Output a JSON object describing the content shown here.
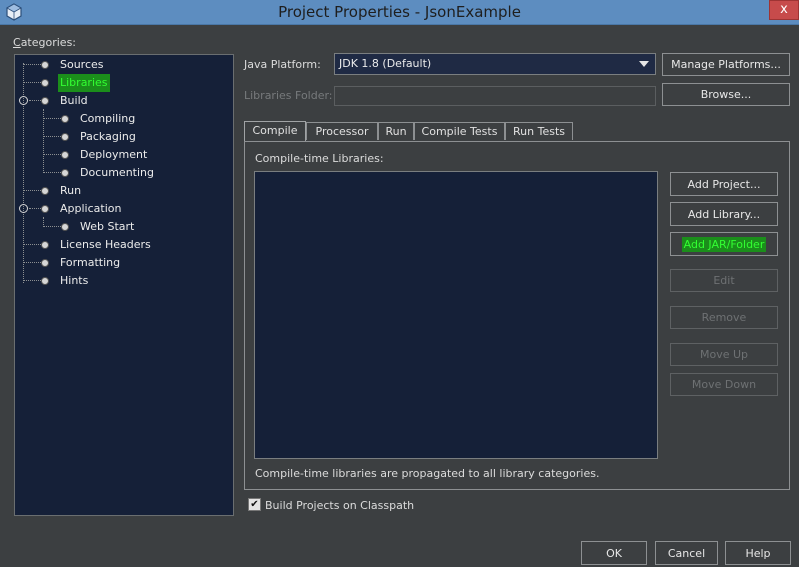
{
  "window": {
    "title": "Project Properties - JsonExample",
    "close_glyph": "x"
  },
  "categories": {
    "label": "Categories:",
    "items": [
      {
        "label": "Sources",
        "level": 0
      },
      {
        "label": "Libraries",
        "level": 0,
        "selected": true
      },
      {
        "label": "Build",
        "level": 0,
        "expanded": true
      },
      {
        "label": "Compiling",
        "level": 1
      },
      {
        "label": "Packaging",
        "level": 1
      },
      {
        "label": "Deployment",
        "level": 1
      },
      {
        "label": "Documenting",
        "level": 1
      },
      {
        "label": "Run",
        "level": 0
      },
      {
        "label": "Application",
        "level": 0,
        "expanded": true
      },
      {
        "label": "Web Start",
        "level": 1
      },
      {
        "label": "License Headers",
        "level": 0
      },
      {
        "label": "Formatting",
        "level": 0
      },
      {
        "label": "Hints",
        "level": 0
      }
    ]
  },
  "platform": {
    "label": "Java Platform:",
    "value": "JDK 1.8 (Default)",
    "manage_button": "Manage Platforms..."
  },
  "libraries_folder": {
    "label": "Libraries Folder:",
    "value": "",
    "browse_button": "Browse..."
  },
  "tabs": [
    "Compile",
    "Processor",
    "Run",
    "Compile Tests",
    "Run Tests"
  ],
  "active_tab": "Compile",
  "compile_panel": {
    "list_label": "Compile-time Libraries:",
    "footer_note": "Compile-time libraries are propagated to all library categories.",
    "buttons": {
      "add_project": "Add Project...",
      "add_library": "Add Library...",
      "add_jar": "Add JAR/Folder",
      "edit": "Edit",
      "remove": "Remove",
      "move_up": "Move Up",
      "move_down": "Move Down"
    }
  },
  "build_on_classpath": {
    "label": "Build Projects on Classpath",
    "checked": true,
    "check_glyph": "✔"
  },
  "dialog_buttons": {
    "ok": "OK",
    "cancel": "Cancel",
    "help": "Help"
  },
  "colors": {
    "highlight_bg": "#1b8e1b",
    "highlight_fg": "#32ff32",
    "panel_bg": "#3c3f41",
    "list_bg": "#152038"
  }
}
